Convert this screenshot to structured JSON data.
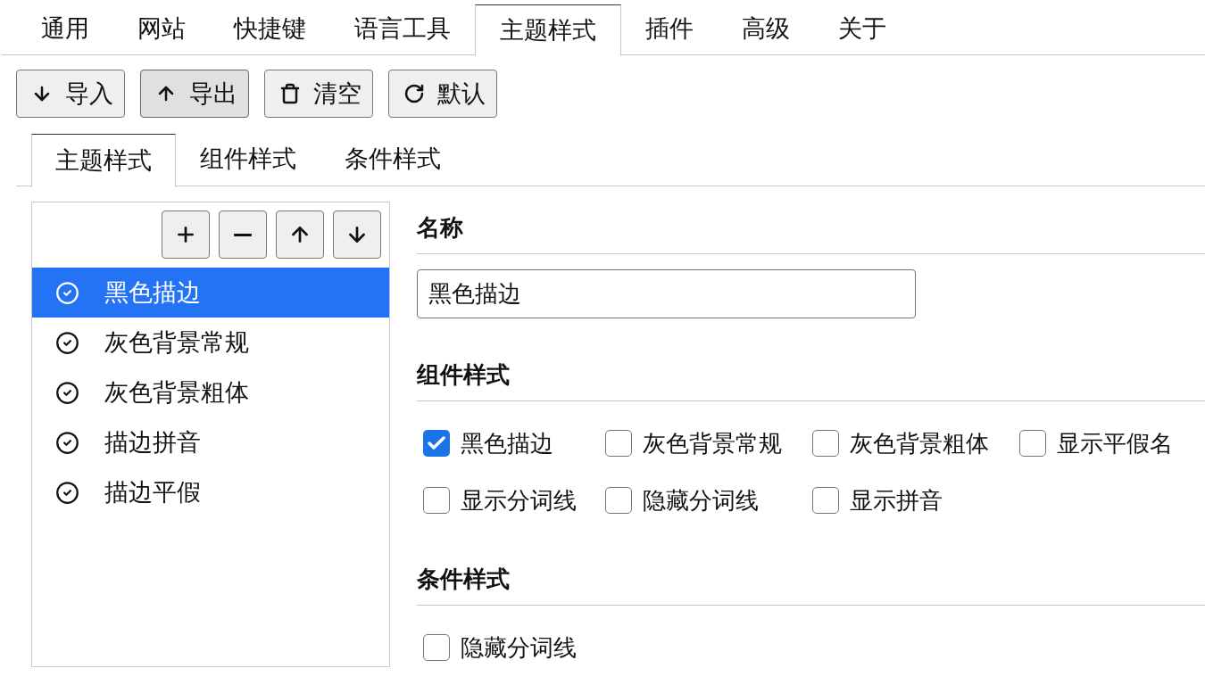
{
  "tabs": [
    {
      "label": "通用",
      "selected": false
    },
    {
      "label": "网站",
      "selected": false
    },
    {
      "label": "快捷键",
      "selected": false
    },
    {
      "label": "语言工具",
      "selected": false
    },
    {
      "label": "主题样式",
      "selected": true
    },
    {
      "label": "插件",
      "selected": false
    },
    {
      "label": "高级",
      "selected": false
    },
    {
      "label": "关于",
      "selected": false
    }
  ],
  "toolbar": [
    {
      "label": "导入",
      "pressed": false
    },
    {
      "label": "导出",
      "pressed": true
    },
    {
      "label": "清空",
      "pressed": false
    },
    {
      "label": "默认",
      "pressed": false
    }
  ],
  "subtabs": [
    {
      "label": "主题样式",
      "selected": true
    },
    {
      "label": "组件样式",
      "selected": false
    },
    {
      "label": "条件样式",
      "selected": false
    }
  ],
  "theme_list": {
    "items": [
      {
        "label": "黑色描边",
        "selected": true
      },
      {
        "label": "灰色背景常规",
        "selected": false
      },
      {
        "label": "灰色背景粗体",
        "selected": false
      },
      {
        "label": "描边拼音",
        "selected": false
      },
      {
        "label": "描边平假",
        "selected": false
      }
    ]
  },
  "name_section": {
    "heading": "名称",
    "value": "黑色描边"
  },
  "component_styles": {
    "heading": "组件样式",
    "options": [
      {
        "label": "黑色描边",
        "checked": true
      },
      {
        "label": "灰色背景常规",
        "checked": false
      },
      {
        "label": "灰色背景粗体",
        "checked": false
      },
      {
        "label": "显示平假名",
        "checked": false
      },
      {
        "label": "显示分词线",
        "checked": false
      },
      {
        "label": "隐藏分词线",
        "checked": false
      },
      {
        "label": "显示拼音",
        "checked": false
      }
    ]
  },
  "condition_styles": {
    "heading": "条件样式",
    "options": [
      {
        "label": "隐藏分词线",
        "checked": false
      }
    ]
  }
}
